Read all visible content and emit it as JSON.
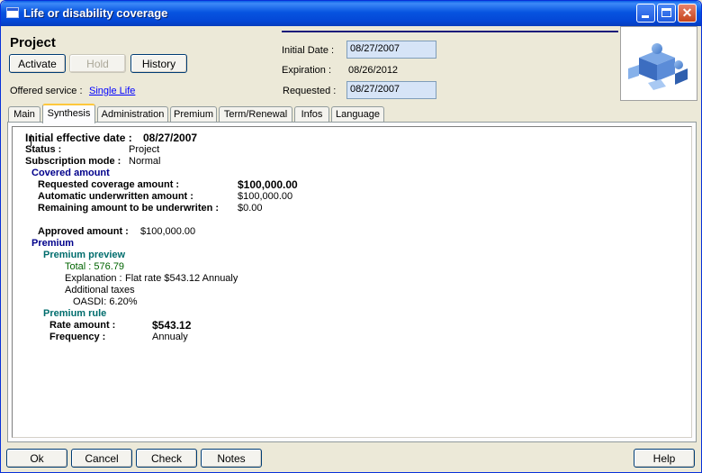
{
  "window": {
    "title": "Life or disability coverage",
    "controls": [
      "minimize-icon",
      "maximize-icon",
      "close-icon"
    ]
  },
  "header": {
    "title": "Project",
    "buttons": {
      "activate": "Activate",
      "hold": "Hold",
      "history": "History"
    },
    "offered_service_label": "Offered service :",
    "offered_service_value": "Single Life",
    "initial_date_label": "Initial Date :",
    "initial_date_value": "08/27/2007",
    "expiration_label": "Expiration :",
    "expiration_value": "08/26/2012",
    "requested_label": "Requested :",
    "requested_value": "08/27/2007"
  },
  "tabs": [
    "Main",
    "Synthesis",
    "Administration",
    "Premium",
    "Term/Renewal",
    "Infos",
    "Language"
  ],
  "active_tab": "Synthesis",
  "synthesis": {
    "initial_effective_label": "Initial effective date :",
    "initial_effective_value": "08/27/2007",
    "status_label": "Status :",
    "status_value": "Project",
    "subscription_label": "Subscription mode :",
    "subscription_value": "Normal",
    "covered_amount_heading": "Covered amount",
    "requested_coverage_label": "Requested coverage amount :",
    "requested_coverage_value": "$100,000.00",
    "auto_underwritten_label": "Automatic underwritten amount :",
    "auto_underwritten_value": "$100,000.00",
    "remaining_label": "Remaining amount to be underwriten :",
    "remaining_value": "$0.00",
    "approved_label": "Approved amount :",
    "approved_value": "$100,000.00",
    "premium_heading": "Premium",
    "premium_preview_heading": "Premium preview",
    "total_text": "Total : 576.79",
    "explanation_label": "Explanation :",
    "explanation_value": "Flat rate $543.12  Annualy",
    "additional_taxes": "Additional taxes",
    "oasdi": "OASDI: 6.20%",
    "premium_rule_heading": "Premium rule",
    "rate_amount_label": "Rate amount :",
    "rate_amount_value": "$543.12",
    "frequency_label": "Frequency :",
    "frequency_value": "Annualy"
  },
  "footer": {
    "ok": "Ok",
    "cancel": "Cancel",
    "check": "Check",
    "notes": "Notes",
    "help": "Help"
  },
  "colors": {
    "titlebar": "#0754e0",
    "heading_blue": "#00008b",
    "heading_teal": "#006d6d",
    "total_green": "#006400"
  }
}
